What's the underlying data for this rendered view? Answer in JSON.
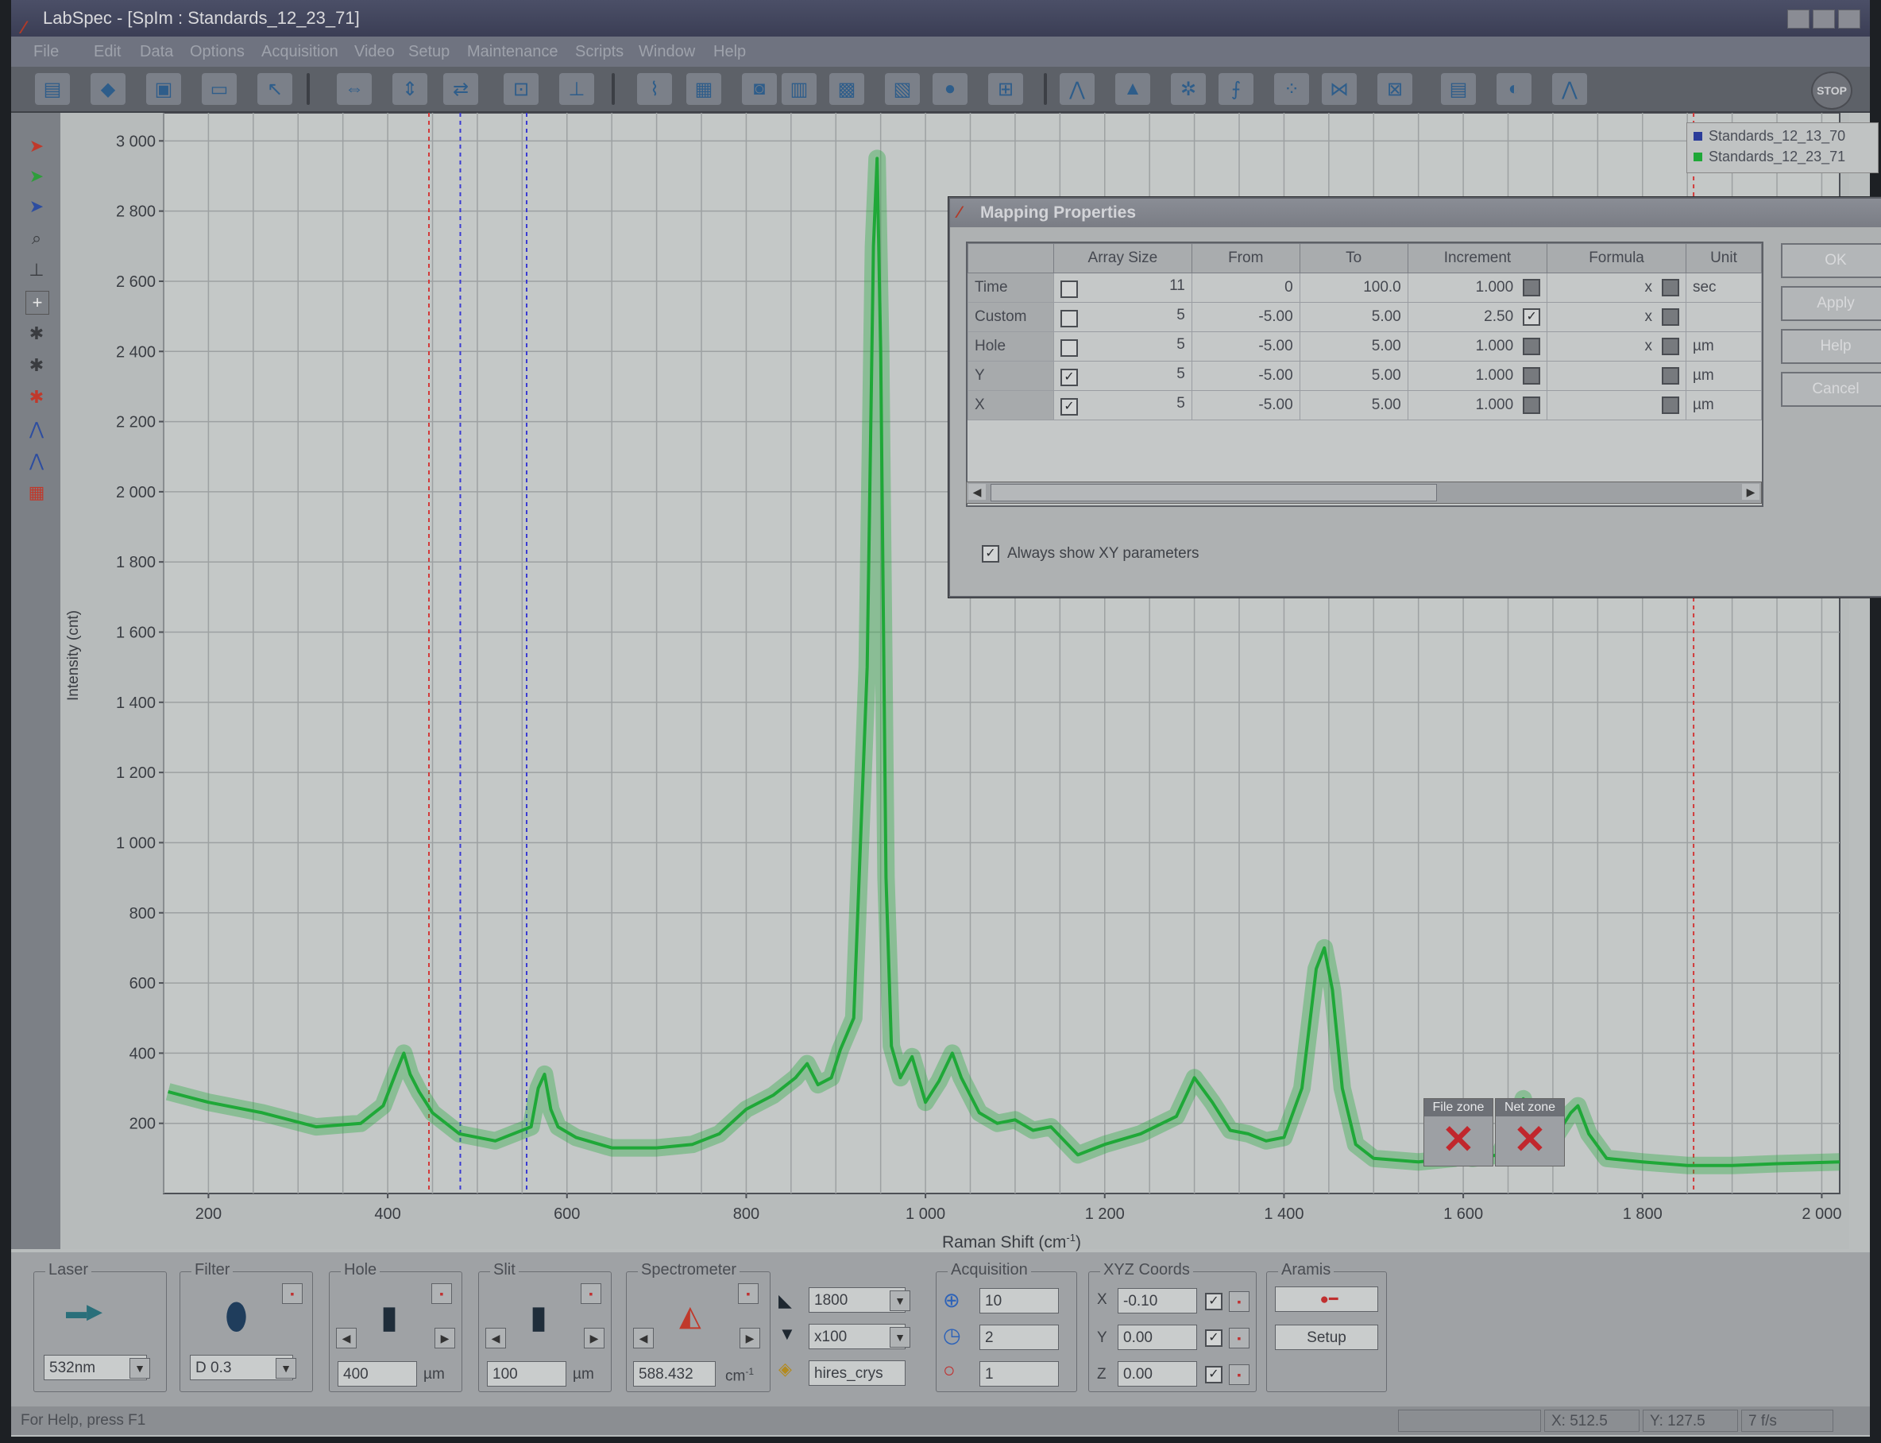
{
  "window": {
    "app_name": "LabSpec",
    "title": "LabSpec - [SpIm : Standards_12_23_71]"
  },
  "menu": [
    "File",
    "Edit",
    "Data",
    "Options",
    "Acquisition",
    "Video",
    "Setup",
    "Maintenance",
    "Scripts",
    "Window",
    "Help"
  ],
  "toolbar": {
    "stop_label": "STOP"
  },
  "legend": [
    {
      "name": "Standards_12_13_70",
      "color": "#2b3c9a"
    },
    {
      "name": "Standards_12_23_71",
      "color": "#1fa838"
    }
  ],
  "chart_data": {
    "type": "line",
    "xlabel": "Raman Shift (cm-1)",
    "xlabel_main": "Raman Shift (cm",
    "xlabel_sup": "-1",
    "xlabel_close": ")",
    "ylabel": "Intensity (cnt)",
    "xlim": [
      150,
      2020
    ],
    "ylim": [
      0,
      3080
    ],
    "x_ticks": [
      200,
      400,
      600,
      800,
      1000,
      1200,
      1400,
      1600,
      1800,
      2000
    ],
    "x_tick_labels": [
      "200",
      "400",
      "600",
      "800",
      "1 000",
      "1 200",
      "1 400",
      "1 600",
      "1 800",
      "2 000"
    ],
    "y_ticks": [
      200,
      400,
      600,
      800,
      1000,
      1200,
      1400,
      1600,
      1800,
      2000,
      2200,
      2400,
      2600,
      2800,
      3000
    ],
    "y_tick_labels": [
      "200",
      "400",
      "600",
      "800",
      "1 000",
      "1 200",
      "1 400",
      "1 600",
      "1 800",
      "2 000",
      "2 200",
      "2 400",
      "2 600",
      "2 800",
      "3 000"
    ],
    "vertical_markers": [
      {
        "x": 446,
        "color": "#d23a3a"
      },
      {
        "x": 481,
        "color": "#3a3ad2"
      },
      {
        "x": 555,
        "color": "#3a3ad2"
      },
      {
        "x": 1857,
        "color": "#d23a3a"
      }
    ],
    "series": [
      {
        "name": "Standards_12_23_71",
        "color": "#1fa838",
        "x": [
          155,
          200,
          260,
          320,
          370,
          395,
          410,
          418,
          425,
          435,
          450,
          480,
          520,
          560,
          568,
          575,
          582,
          590,
          610,
          650,
          700,
          740,
          770,
          800,
          830,
          855,
          868,
          880,
          895,
          905,
          920,
          935,
          942,
          946,
          950,
          956,
          962,
          972,
          985,
          1000,
          1015,
          1030,
          1040,
          1050,
          1060,
          1080,
          1100,
          1120,
          1140,
          1170,
          1200,
          1240,
          1280,
          1300,
          1320,
          1340,
          1360,
          1380,
          1400,
          1420,
          1436,
          1445,
          1454,
          1465,
          1480,
          1500,
          1550,
          1590,
          1600,
          1610,
          1640,
          1660,
          1667,
          1680,
          1700,
          1720,
          1728,
          1740,
          1760,
          1800,
          1850,
          1900,
          1950,
          2020
        ],
        "y": [
          290,
          260,
          230,
          190,
          200,
          250,
          350,
          400,
          340,
          290,
          230,
          170,
          150,
          190,
          300,
          340,
          240,
          190,
          160,
          130,
          130,
          140,
          170,
          240,
          280,
          330,
          370,
          310,
          330,
          410,
          500,
          1500,
          2700,
          2950,
          2400,
          900,
          420,
          330,
          390,
          260,
          320,
          400,
          330,
          280,
          230,
          200,
          210,
          180,
          190,
          110,
          140,
          170,
          220,
          330,
          260,
          180,
          170,
          150,
          160,
          300,
          640,
          700,
          580,
          300,
          140,
          100,
          90,
          100,
          120,
          100,
          110,
          220,
          270,
          140,
          150,
          230,
          250,
          170,
          100,
          90,
          80,
          80,
          85,
          90
        ]
      }
    ]
  },
  "dialog": {
    "title": "Mapping Properties",
    "columns": [
      "",
      "Array Size",
      "From",
      "To",
      "Increment",
      "Formula",
      "Unit"
    ],
    "rows": [
      {
        "name": "Time",
        "checked": false,
        "size": "11",
        "from": "0",
        "to": "100.0",
        "inc": "1.000",
        "inc_check": false,
        "formula": "x",
        "unit": "sec"
      },
      {
        "name": "Custom",
        "checked": false,
        "size": "5",
        "from": "-5.00",
        "to": "5.00",
        "inc": "2.50",
        "inc_check": true,
        "formula": "x",
        "unit": ""
      },
      {
        "name": "Hole",
        "checked": false,
        "size": "5",
        "from": "-5.00",
        "to": "5.00",
        "inc": "1.000",
        "inc_check": false,
        "formula": "x",
        "unit": "µm"
      },
      {
        "name": "Y",
        "checked": true,
        "size": "5",
        "from": "-5.00",
        "to": "5.00",
        "inc": "1.000",
        "inc_check": false,
        "formula": "",
        "unit": "µm"
      },
      {
        "name": "X",
        "checked": true,
        "size": "5",
        "from": "-5.00",
        "to": "5.00",
        "inc": "1.000",
        "inc_check": false,
        "formula": "",
        "unit": "µm"
      }
    ],
    "buttons": {
      "ok": "OK",
      "apply": "Apply",
      "help": "Help",
      "cancel": "Cancel"
    },
    "always_show": "Always show XY parameters"
  },
  "zones": {
    "file": "File zone",
    "net": "Net zone"
  },
  "panel": {
    "laser": {
      "label": "Laser",
      "value": "532nm"
    },
    "filter": {
      "label": "Filter",
      "value": "D 0.3"
    },
    "hole": {
      "label": "Hole",
      "value": "400",
      "unit": "µm"
    },
    "slit": {
      "label": "Slit",
      "value": "100",
      "unit": "µm"
    },
    "spectrometer": {
      "label": "Spectrometer",
      "value": "588.432",
      "unit": "cm",
      "unit_sup": "-1"
    },
    "grating": {
      "value": "1800",
      "objective": "x100",
      "config": "hires_crys"
    },
    "acquisition": {
      "label": "Acquisition",
      "time": "10",
      "accum": "2",
      "count": "1"
    },
    "xyz": {
      "label": "XYZ Coords",
      "x_label": "X",
      "y_label": "Y",
      "z_label": "Z",
      "x": "-0.10",
      "y": "0.00",
      "z": "0.00"
    },
    "aramis": {
      "label": "Aramis",
      "setup": "Setup"
    }
  },
  "status": {
    "help": "For Help, press F1",
    "x": "X: 512.5",
    "y": "Y: 127.5",
    "fps": "7 f/s"
  }
}
